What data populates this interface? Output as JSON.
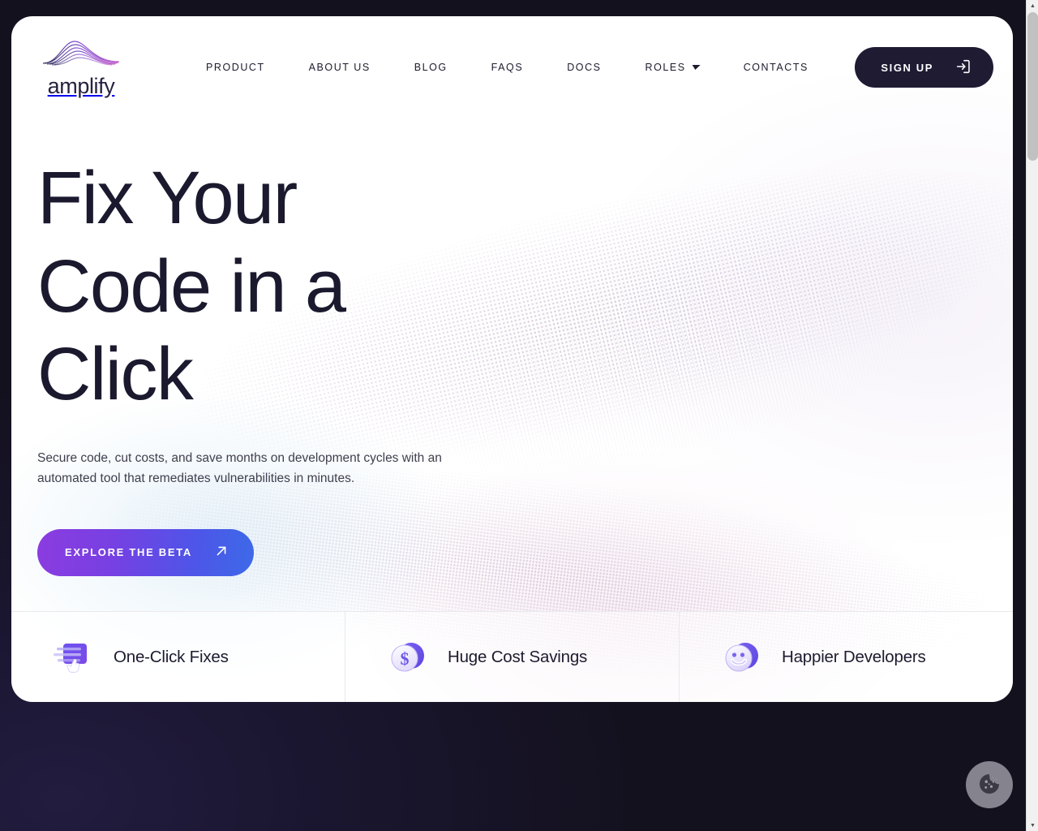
{
  "brand": {
    "name": "amplify",
    "logo_icon": "wave-logo-icon"
  },
  "nav": {
    "items": [
      {
        "label": "PRODUCT",
        "icon": null
      },
      {
        "label": "ABOUT US",
        "icon": null
      },
      {
        "label": "BLOG",
        "icon": null
      },
      {
        "label": "FAQS",
        "icon": null
      },
      {
        "label": "DOCS",
        "icon": null
      },
      {
        "label": "ROLES",
        "icon": "chevron-down-icon"
      },
      {
        "label": "CONTACTS",
        "icon": null
      }
    ],
    "signup": {
      "label": "SIGN UP",
      "icon": "login-arrow-icon"
    }
  },
  "hero": {
    "title": "Fix Your Code in a Click",
    "subtitle": "Secure code, cut costs, and save months on development cycles with an automated tool that remediates vulnerabilities in minutes.",
    "cta": {
      "label": "EXPLORE THE BETA",
      "icon": "arrow-up-right-icon"
    }
  },
  "features": [
    {
      "label": "One-Click Fixes",
      "icon": "one-click-fix-icon"
    },
    {
      "label": "Huge Cost Savings",
      "icon": "dollar-coin-icon"
    },
    {
      "label": "Happier Developers",
      "icon": "smiley-face-icon"
    }
  ],
  "cookie_consent": {
    "icon": "cookie-icon",
    "label": ""
  },
  "scrollbar": {
    "up_arrow": "▲",
    "down_arrow": "▼"
  },
  "colors": {
    "page_background": "#14111f",
    "card_background": "#ffffff",
    "text_dark": "#1b192e",
    "accent_purple": "#8b3ce0",
    "accent_blue": "#3d6ae8",
    "signup_background": "#1e1b33"
  }
}
